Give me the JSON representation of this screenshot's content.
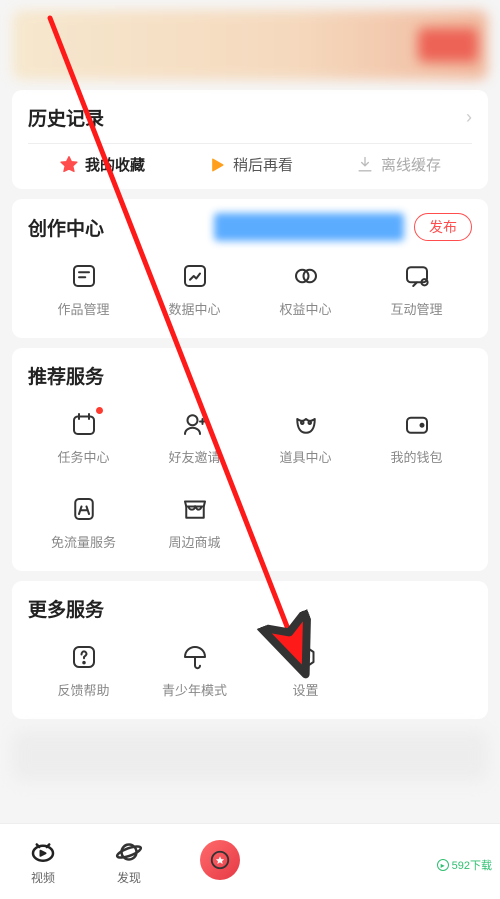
{
  "history": {
    "title": "历史记录"
  },
  "tabs": {
    "fav": "我的收藏",
    "watch_later": "稍后再看",
    "offline": "离线缓存"
  },
  "creation": {
    "title": "创作中心",
    "publish": "发布",
    "items": [
      {
        "label": "作品管理"
      },
      {
        "label": "数据中心"
      },
      {
        "label": "权益中心"
      },
      {
        "label": "互动管理"
      }
    ]
  },
  "recommend": {
    "title": "推荐服务",
    "items": [
      {
        "label": "任务中心"
      },
      {
        "label": "好友邀请"
      },
      {
        "label": "道具中心"
      },
      {
        "label": "我的钱包"
      },
      {
        "label": "免流量服务"
      },
      {
        "label": "周边商城"
      }
    ]
  },
  "more": {
    "title": "更多服务",
    "items": [
      {
        "label": "反馈帮助"
      },
      {
        "label": "青少年模式"
      },
      {
        "label": "设置"
      }
    ]
  },
  "nav": {
    "video": "视频",
    "discover": "发现"
  },
  "watermark": "592下载"
}
